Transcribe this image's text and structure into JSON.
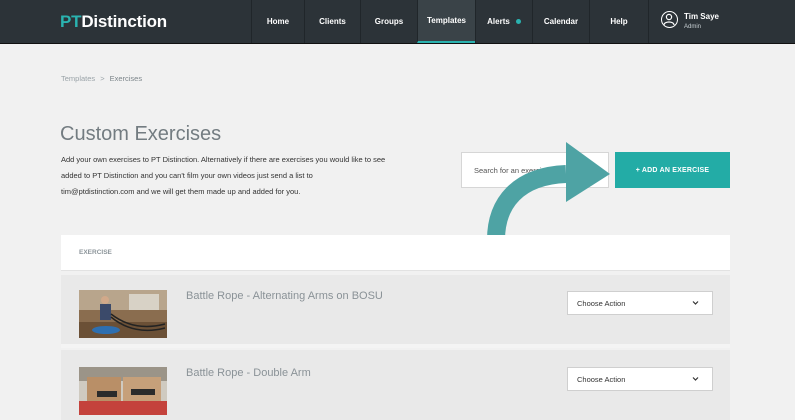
{
  "app": {
    "logo_prefix": "PT",
    "logo_suffix": "Distinction"
  },
  "nav": {
    "items": [
      {
        "label": "Home"
      },
      {
        "label": "Clients"
      },
      {
        "label": "Groups"
      },
      {
        "label": "Templates",
        "active": true
      },
      {
        "label": "Alerts",
        "has_dot": true
      },
      {
        "label": "Calendar"
      },
      {
        "label": "Help"
      }
    ],
    "user": {
      "name": "Tim Saye",
      "role": "Admin",
      "icon": "user-avatar-icon"
    }
  },
  "breadcrumb": {
    "parent": "Templates",
    "separator": ">",
    "current": "Exercises"
  },
  "page": {
    "title": "Custom Exercises",
    "intro": "Add your own exercises to PT Distinction. Alternatively if there are exercises you would like to see added to PT Distinction and you can't film your own videos just send a list to tim@ptdistinction.com and we will get them made up and added for you."
  },
  "search": {
    "placeholder": "Search for an exercise",
    "value": ""
  },
  "add_button": {
    "label": "+ ADD AN EXERCISE"
  },
  "table": {
    "column_header": "EXERCISE",
    "rows": [
      {
        "title": "Battle Rope - Alternating Arms on BOSU",
        "action": "Choose Action"
      },
      {
        "title": "Battle Rope - Double Arm",
        "action": "Choose Action"
      }
    ]
  },
  "colors": {
    "accent": "#23aca6",
    "topbar": "#2c3338",
    "background": "#f1f1f1"
  }
}
